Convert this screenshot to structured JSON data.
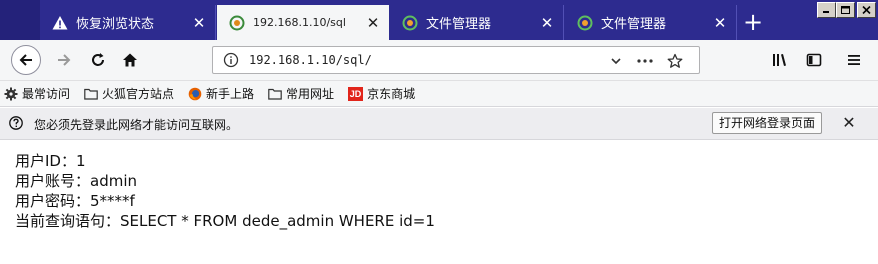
{
  "tabs": [
    {
      "title": "恢复浏览状态",
      "icon": "warning-icon",
      "active": false
    },
    {
      "title": "192.168.1.10/sql",
      "icon": "site-icon",
      "active": true
    },
    {
      "title": "文件管理器",
      "icon": "site-icon",
      "active": false
    },
    {
      "title": "文件管理器",
      "icon": "site-icon",
      "active": false
    }
  ],
  "tab_close_glyph": "✕",
  "newtab_glyph": "+",
  "url": "192.168.1.10/sql/",
  "bookmarks": [
    {
      "label": "最常访问",
      "icon": "gear-icon"
    },
    {
      "label": "火狐官方站点",
      "icon": "folder-icon"
    },
    {
      "label": "新手上路",
      "icon": "firefox-icon"
    },
    {
      "label": "常用网址",
      "icon": "folder-icon"
    },
    {
      "label": "京东商城",
      "icon": "jd-icon",
      "badge": "JD"
    }
  ],
  "notification": {
    "text": "您必须先登录此网络才能访问互联网。",
    "button": "打开网络登录页面",
    "close": "✕"
  },
  "content": {
    "lines": [
      "用户ID：1",
      "用户账号：admin",
      "用户密码：5****f",
      "当前查询语句：SELECT * FROM dede_admin WHERE id=1"
    ]
  },
  "colors": {
    "tabstrip": "#2d2b8f",
    "toolbar": "#f5f6f7",
    "notification": "#ededf0",
    "jd_red": "#e1251b"
  }
}
